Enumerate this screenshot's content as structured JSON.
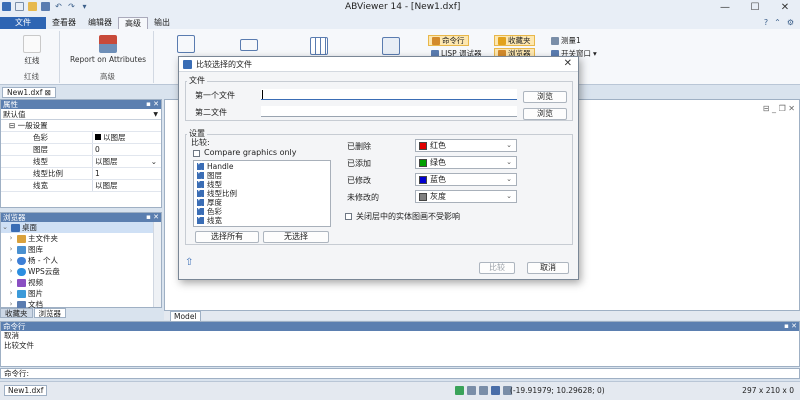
{
  "app": {
    "title": "ABViewer 14 - [New1.dxf]"
  },
  "menu_tabs": [
    {
      "label": "文件"
    },
    {
      "label": "查看器"
    },
    {
      "label": "编辑器"
    },
    {
      "label": "高级"
    },
    {
      "label": "输出"
    }
  ],
  "ribbon": {
    "redline_button": "红线",
    "redline_group": "红线",
    "report_button": "Report on Attributes",
    "advanced_group": "高级",
    "command_line": "命令行",
    "lisp_debugger": "LISP 调试器",
    "favorites": "收藏夹",
    "browser": "浏览器",
    "measure": "测量1",
    "open_close": "开关窗口"
  },
  "doc_tab": "New1.dxf",
  "properties_panel": {
    "title": "属性",
    "combo_value": "默认值",
    "section": "一般设置",
    "rows": [
      {
        "key": "色彩",
        "value": "以图层"
      },
      {
        "key": "图层",
        "value": "0"
      },
      {
        "key": "线型",
        "value": "以图层"
      },
      {
        "key": "线型比例",
        "value": "1"
      },
      {
        "key": "线宽",
        "value": "以图层"
      }
    ]
  },
  "explorer_panel": {
    "title": "浏览器",
    "items": [
      {
        "label": "桌面"
      },
      {
        "label": "主文件夹"
      },
      {
        "label": "图库"
      },
      {
        "label": "杨 - 个人"
      },
      {
        "label": "WPS云盘"
      },
      {
        "label": "视频"
      },
      {
        "label": "图片"
      },
      {
        "label": "文档"
      }
    ]
  },
  "panel_tabs": [
    {
      "label": "收藏夹"
    },
    {
      "label": "浏览器"
    }
  ],
  "model_tab": "Model",
  "command_panel": {
    "title": "命令行",
    "lines": [
      "取消",
      "比较文件"
    ],
    "input_label": "命令行:"
  },
  "status": {
    "file": "New1.dxf",
    "coords": "(-19.91979; 10.29628; 0)",
    "size": "297 x 210 x 0"
  },
  "dialog": {
    "title": "比较选择的文件",
    "files_legend": "文件",
    "first_file_label": "第一个文件",
    "second_file_label": "第二文件",
    "first_file_value": "",
    "second_file_value": "",
    "browse": "浏览",
    "settings_legend": "设置",
    "compare_label": "比较:",
    "compare_graphics": "Compare graphics only",
    "compare_items": [
      {
        "label": "Handle",
        "checked": true
      },
      {
        "label": "图层",
        "checked": true
      },
      {
        "label": "线型",
        "checked": true
      },
      {
        "label": "线型比例",
        "checked": true
      },
      {
        "label": "厚度",
        "checked": true
      },
      {
        "label": "色彩",
        "checked": true
      },
      {
        "label": "线宽",
        "checked": true
      }
    ],
    "select_all": "选择所有",
    "select_none": "无选择",
    "colors": [
      {
        "label": "已删除",
        "value": "红色",
        "swatch": "#e00000"
      },
      {
        "label": "已添加",
        "value": "绿色",
        "swatch": "#00a000"
      },
      {
        "label": "已修改",
        "value": "蓝色",
        "swatch": "#0000d0"
      },
      {
        "label": "未修改的",
        "value": "灰度",
        "swatch": "#808080"
      }
    ],
    "ignore_off_layers": "关闭层中的实体图画不受影响",
    "compare_button": "比较",
    "cancel_button": "取消"
  }
}
